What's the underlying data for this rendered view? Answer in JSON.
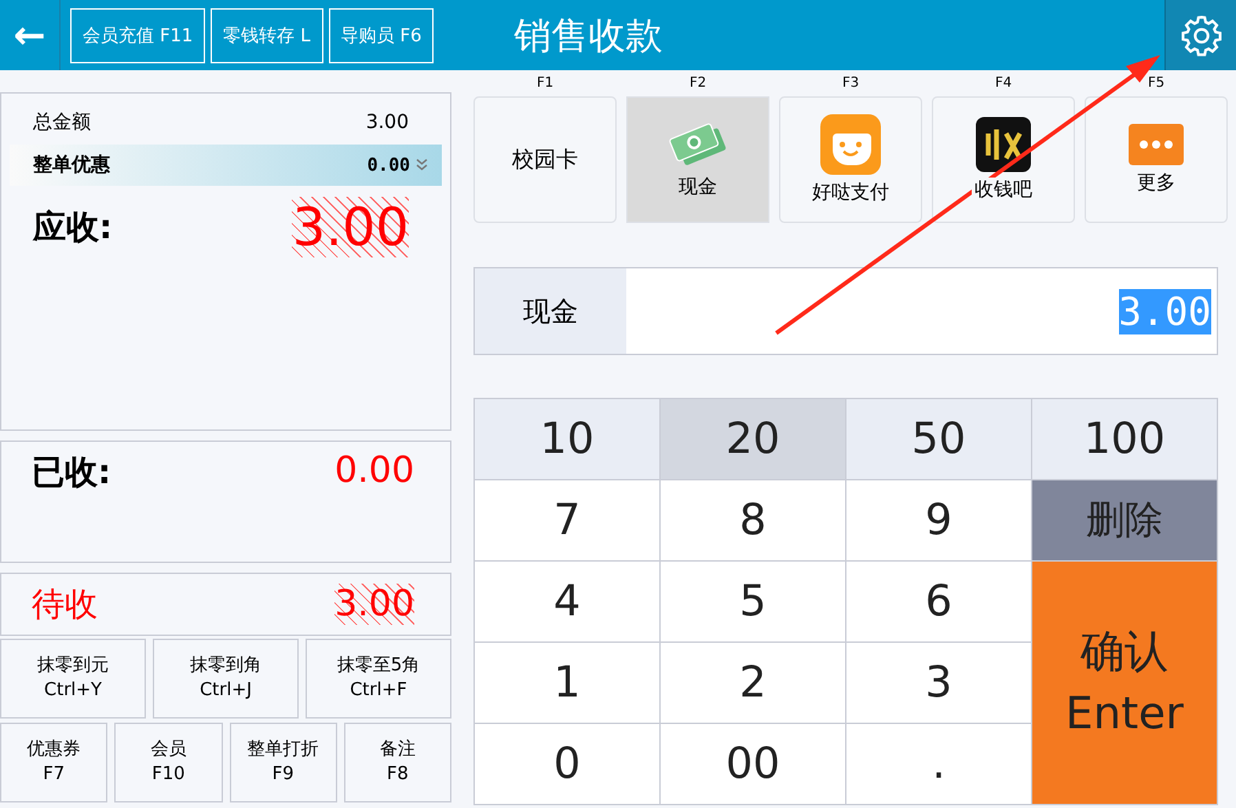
{
  "header": {
    "back": "←",
    "actions": [
      {
        "label": "会员充值 F11"
      },
      {
        "label": "零钱转存 L"
      },
      {
        "label": "导购员 F6"
      }
    ],
    "title": "销售收款"
  },
  "summary": {
    "total_label": "总金额",
    "total": "3.00",
    "discount_label": "整单优惠",
    "discount": "0.00",
    "due_label": "应收:",
    "due": "3.00"
  },
  "received": {
    "label": "已收:",
    "amount": "0.00"
  },
  "pending": {
    "label": "待收",
    "amount": "3.00"
  },
  "rounding": [
    {
      "label": "抹零到元",
      "key": "Ctrl+Y"
    },
    {
      "label": "抹零到角",
      "key": "Ctrl+J"
    },
    {
      "label": "抹零至5角",
      "key": "Ctrl+F"
    }
  ],
  "extras": [
    {
      "label": "优惠券",
      "key": "F7"
    },
    {
      "label": "会员",
      "key": "F10"
    },
    {
      "label": "整单打折",
      "key": "F9"
    },
    {
      "label": "备注",
      "key": "F8"
    }
  ],
  "methods": [
    {
      "key": "F1",
      "label": "校园卡",
      "kind": "text",
      "selected": false
    },
    {
      "key": "F2",
      "label": "现金",
      "kind": "cash",
      "selected": true
    },
    {
      "key": "F3",
      "label": "好哒支付",
      "kind": "face",
      "selected": false
    },
    {
      "key": "F4",
      "label": "收钱吧",
      "kind": "dark",
      "selected": false
    },
    {
      "key": "F5",
      "label": "更多",
      "kind": "more",
      "selected": false
    }
  ],
  "amount_field": {
    "label": "现金",
    "value": "3.00"
  },
  "keys": [
    {
      "label": "10",
      "kind": "quick",
      "selected": false
    },
    {
      "label": "20",
      "kind": "quick",
      "selected": true
    },
    {
      "label": "50",
      "kind": "quick",
      "selected": false
    },
    {
      "label": "100",
      "kind": "quick",
      "selected": false
    },
    {
      "label": "7",
      "kind": "digit"
    },
    {
      "label": "8",
      "kind": "digit"
    },
    {
      "label": "9",
      "kind": "digit"
    },
    {
      "label": "删除",
      "kind": "delete"
    },
    {
      "label": "4",
      "kind": "digit"
    },
    {
      "label": "5",
      "kind": "digit"
    },
    {
      "label": "6",
      "kind": "digit"
    },
    {
      "label": "1",
      "kind": "digit"
    },
    {
      "label": "2",
      "kind": "digit"
    },
    {
      "label": "3",
      "kind": "digit"
    },
    {
      "label": "0",
      "kind": "digit"
    },
    {
      "label": "00",
      "kind": "digit"
    },
    {
      "label": ".",
      "kind": "digit"
    },
    {
      "label": "确认 Enter",
      "kind": "confirm"
    }
  ],
  "annotation": {
    "kind": "arrow"
  }
}
